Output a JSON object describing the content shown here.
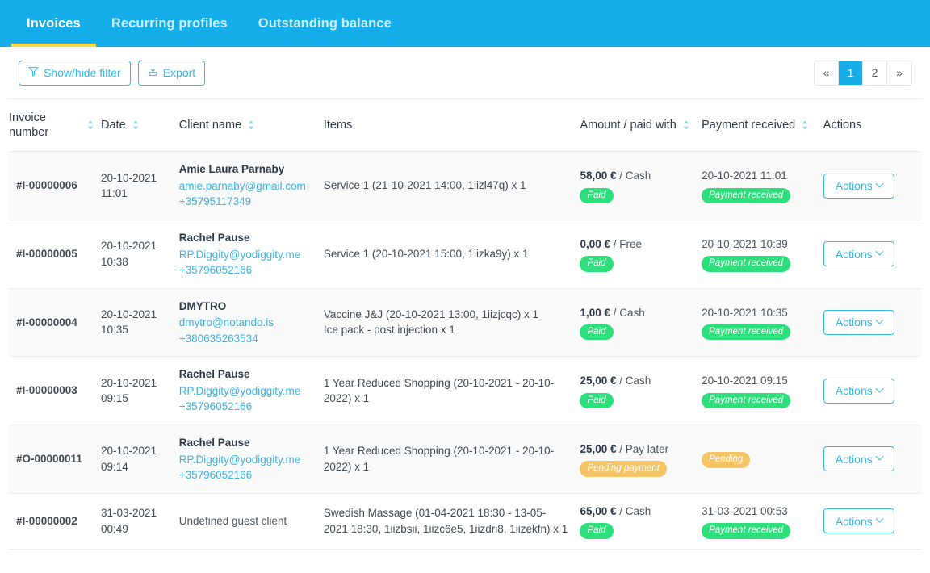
{
  "tabs": [
    {
      "label": "Invoices",
      "active": true
    },
    {
      "label": "Recurring profiles",
      "active": false
    },
    {
      "label": "Outstanding balance",
      "active": false
    }
  ],
  "toolbar": {
    "filter_label": "Show/hide filter",
    "filter_icon": "funnel-icon",
    "export_label": "Export",
    "export_icon": "export-download-icon"
  },
  "pagination": {
    "first_label": "«",
    "pages": [
      "1",
      "2"
    ],
    "active_page": "1",
    "last_label": "»"
  },
  "table": {
    "columns": [
      {
        "label": "Invoice number",
        "sortable": true
      },
      {
        "label": "Date",
        "sortable": true
      },
      {
        "label": "Client name",
        "sortable": true
      },
      {
        "label": "Items",
        "sortable": false
      },
      {
        "label": "Amount / paid with",
        "sortable": true
      },
      {
        "label": "Payment received",
        "sortable": true
      },
      {
        "label": "Actions",
        "sortable": false
      }
    ],
    "actions_label": "Actions",
    "rows": [
      {
        "invoice_number": "#I-00000006",
        "date": "20-10-2021 11:01",
        "client_name": "Amie Laura Parnaby",
        "client_email": "amie.parnaby@gmail.com",
        "client_phone": "+35795117349",
        "items": [
          "Service 1 (21-10-2021 14:00, 1iizl47q) x 1"
        ],
        "amount": "58,00 €",
        "paid_with": "/ Cash",
        "amount_badge": "Paid",
        "amount_badge_color": "green",
        "payment_received_date": "20-10-2021 11:01",
        "payment_badge": "Payment received",
        "payment_badge_color": "green"
      },
      {
        "invoice_number": "#I-00000005",
        "date": "20-10-2021 10:38",
        "client_name": "Rachel Pause",
        "client_email": "RP.Diggity@yodiggity.me",
        "client_phone": "+35796052166",
        "items": [
          "Service 1 (20-10-2021 15:00, 1iizka9y) x 1"
        ],
        "amount": "0,00 €",
        "paid_with": "/ Free",
        "amount_badge": "Paid",
        "amount_badge_color": "green",
        "payment_received_date": "20-10-2021 10:39",
        "payment_badge": "Payment received",
        "payment_badge_color": "green"
      },
      {
        "invoice_number": "#I-00000004",
        "date": "20-10-2021 10:35",
        "client_name": "DMYTRO",
        "client_email": "dmytro@notando.is",
        "client_phone": "+380635263534",
        "items": [
          "Vaccine J&J (20-10-2021 13:00, 1iizjcqc) x 1",
          "Ice pack - post injection x 1"
        ],
        "amount": "1,00 €",
        "paid_with": "/ Cash",
        "amount_badge": "Paid",
        "amount_badge_color": "green",
        "payment_received_date": "20-10-2021 10:35",
        "payment_badge": "Payment received",
        "payment_badge_color": "green"
      },
      {
        "invoice_number": "#I-00000003",
        "date": "20-10-2021 09:15",
        "client_name": "Rachel Pause",
        "client_email": "RP.Diggity@yodiggity.me",
        "client_phone": "+35796052166",
        "items": [
          "1 Year Reduced Shopping (20-10-2021 - 20-10-2022) x 1"
        ],
        "amount": "25,00 €",
        "paid_with": "/ Cash",
        "amount_badge": "Paid",
        "amount_badge_color": "green",
        "payment_received_date": "20-10-2021 09:15",
        "payment_badge": "Payment received",
        "payment_badge_color": "green"
      },
      {
        "invoice_number": "#O-00000011",
        "date": "20-10-2021 09:14",
        "client_name": "Rachel Pause",
        "client_email": "RP.Diggity@yodiggity.me",
        "client_phone": "+35796052166",
        "items": [
          "1 Year Reduced Shopping (20-10-2021 - 20-10-2022) x 1"
        ],
        "amount": "25,00 €",
        "paid_with": "/ Pay later",
        "amount_badge": "Pending payment",
        "amount_badge_color": "orange",
        "payment_received_date": "",
        "payment_badge": "Pending",
        "payment_badge_color": "orange"
      },
      {
        "invoice_number": "#I-00000002",
        "date": "31-03-2021 00:49",
        "client_name": "Undefined guest client",
        "client_email": "",
        "client_phone": "",
        "items": [
          "Swedish Massage (01-04-2021 18:30 - 13-05-2021 18:30, 1iizbsii, 1iizc6e5, 1iizdri8, 1iizekfn) x 1"
        ],
        "amount": "65,00 €",
        "paid_with": "/ Cash",
        "amount_badge": "Paid",
        "amount_badge_color": "green",
        "payment_received_date": "31-03-2021 00:53",
        "payment_badge": "Payment received",
        "payment_badge_color": "green"
      }
    ]
  },
  "colors": {
    "header_blue": "#16aeea",
    "active_tab_underline": "#f6d84f",
    "accent_blue": "#31b9f0",
    "badge_green": "#2ee07c",
    "badge_orange": "#f7c566"
  }
}
